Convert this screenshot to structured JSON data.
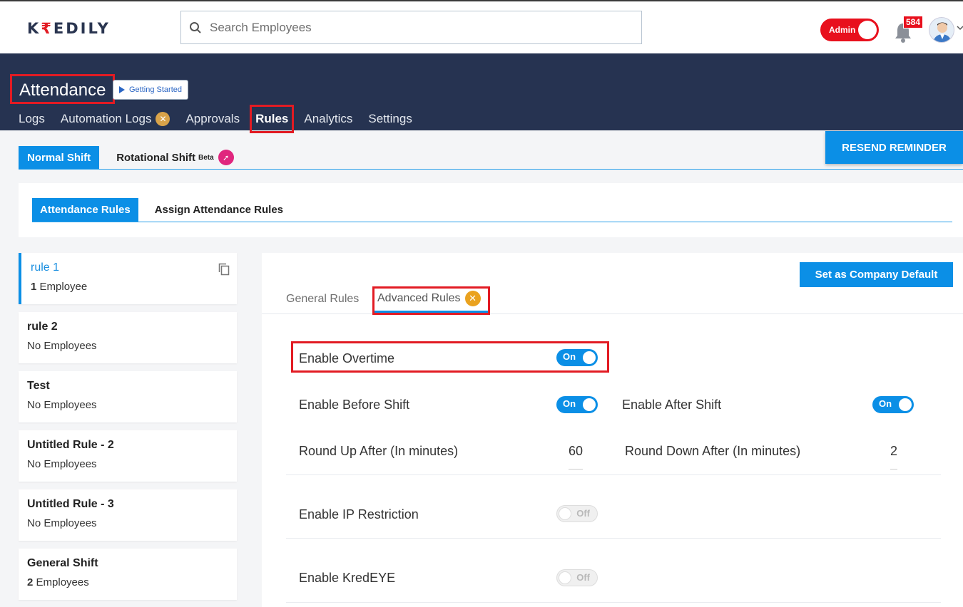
{
  "topbar": {
    "logo_prefix": "K",
    "logo_accent": "₹",
    "logo_suffix": "EDILY",
    "search_placeholder": "Search Employees",
    "admin_label": "Admin",
    "notification_count": "584"
  },
  "header": {
    "title": "Attendance",
    "getting_started": "Getting Started",
    "nav": [
      "Logs",
      "Automation Logs",
      "Approvals",
      "Rules",
      "Analytics",
      "Settings"
    ],
    "active_nav": "Rules"
  },
  "shift_tabs": {
    "normal": "Normal Shift",
    "rotational": "Rotational Shift",
    "rotational_tag": "Beta",
    "resend": "RESEND REMINDER"
  },
  "rules_tabs": {
    "attendance_rules": "Attendance Rules",
    "assign_rules": "Assign Attendance Rules"
  },
  "sidebar": {
    "rules": [
      {
        "name": "rule 1",
        "count": "1",
        "count_label": "Employee"
      },
      {
        "name": "rule 2",
        "count": "",
        "count_label": "No Employees"
      },
      {
        "name": "Test",
        "count": "",
        "count_label": "No Employees"
      },
      {
        "name": "Untitled Rule - 2",
        "count": "",
        "count_label": "No Employees"
      },
      {
        "name": "Untitled Rule - 3",
        "count": "",
        "count_label": "No Employees"
      },
      {
        "name": "General Shift",
        "count": "2",
        "count_label": "Employees"
      }
    ]
  },
  "main": {
    "default_button": "Set as Company Default",
    "tab_general": "General Rules",
    "tab_advanced": "Advanced Rules",
    "overtime_label": "Enable Overtime",
    "overtime_state": "On",
    "before_shift_label": "Enable Before Shift",
    "before_shift_state": "On",
    "after_shift_label": "Enable After Shift",
    "after_shift_state": "On",
    "round_up_label": "Round Up After (In minutes)",
    "round_up_value": "60",
    "round_down_label": "Round Down After (In minutes)",
    "round_down_value": "2",
    "ip_label": "Enable IP Restriction",
    "ip_state": "Off",
    "kredeye_label": "Enable KredEYE",
    "kredeye_state": "Off"
  },
  "colors": {
    "brand_dark": "#263351",
    "accent_blue": "#0b8fe6",
    "highlight_red": "#e21b23"
  }
}
